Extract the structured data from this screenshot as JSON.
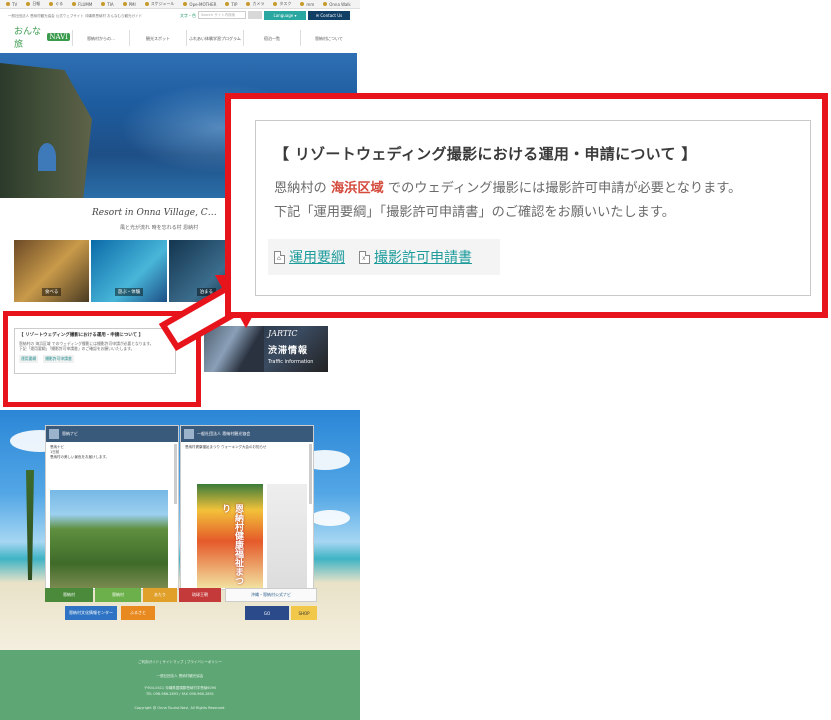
{
  "bookmarks": [
    "TV",
    "日報",
    "ぐる",
    "FLUMM",
    "TIA",
    "PMI",
    "スケジュール",
    "Ope-MOTHER",
    "TIP",
    "カメラ",
    "タスク",
    "mm",
    "Onna Walk",
    "Y"
  ],
  "site": {
    "topbar_text": "一般社団法人 恩納村観光協会 公式ウェブサイト 沖縄県恩納村 おんなむら観光ガイド",
    "text_size_label": "文字・色",
    "search_placeholder": "Search サイト内検索",
    "language_button": "Language ▾",
    "contact_button": "✉ Contact Us",
    "logo_text": "おんな旅",
    "logo_tag": "NAVI",
    "nav": [
      "恩納村からの…",
      "観光スポット",
      "ふれあい体験学習プログラム",
      "宿泊一覧",
      "恩納村について"
    ],
    "tagline": "Resort in Onna Village, C…",
    "subline": "風と光が流れ 時を忘れる村 恩納村",
    "photo_labels": [
      "食べる",
      "遊ぶ・体験",
      "泊まる"
    ],
    "notice_title": "【 リゾートウェディング撮影における運用・申請について 】",
    "notice_line1": "恩納村の 海浜区域 でのウェディング撮影には撮影許可申請が必要となります。",
    "notice_line2": "下記「運用要綱」「撮影許可申請書」のご確認をお願いいたします。",
    "notice_links": [
      "運用要綱",
      "撮影許可申請書"
    ],
    "traffic": {
      "logo": "JARTIC",
      "title": "渋滞情報",
      "subtitle": "Traffic information"
    },
    "fb_left": {
      "page": "恩納ナビ",
      "sub1": "恩納ナビ",
      "sub2": "1日前",
      "post": "恩納村の美しい景色をお届けします。"
    },
    "fb_right": {
      "page": "一般社団法人 恩納村観光協会",
      "post": "恩納村健康福祉まつり ウォーキング大会のお知らせ",
      "poster": "恩納村健康福祉まつり"
    },
    "banners": [
      "恩納村",
      "恩納村",
      "あたり",
      "沖縄・恩納村公式ナビ",
      "恩納村文化情報センター",
      "ふるさと",
      "GO",
      "琉球王朝",
      "SHOP"
    ],
    "footer_links": "ご利用ガイド | サイトマップ | プライバシーポリシー",
    "footer_org": "一般社団法人 恩納村観光協会",
    "footer_addr": "〒904-0411 沖縄県国頭郡恩納村字恩納6090",
    "footer_tel": "TEL 098-966-2893 / FAX 098-966-2891",
    "copyright": "Copyright @ Onna Tourist Navi, All Rights Reserved."
  },
  "callout": {
    "title": "【 リゾートウェディング撮影における運用・申請について 】",
    "line1_pre": "恩納村の ",
    "line1_highlight": "海浜区域",
    "line1_post": " でのウェディング撮影には撮影許可申請が必要となります。",
    "line2": "下記「運用要綱」「撮影許可申請書」のご確認をお願いいたします。",
    "link1": "運用要綱",
    "link2": "撮影許可申請書",
    "highlight_color": "#d44a3c",
    "link_color": "#1e9c9c",
    "frame_color": "#e8141b"
  }
}
